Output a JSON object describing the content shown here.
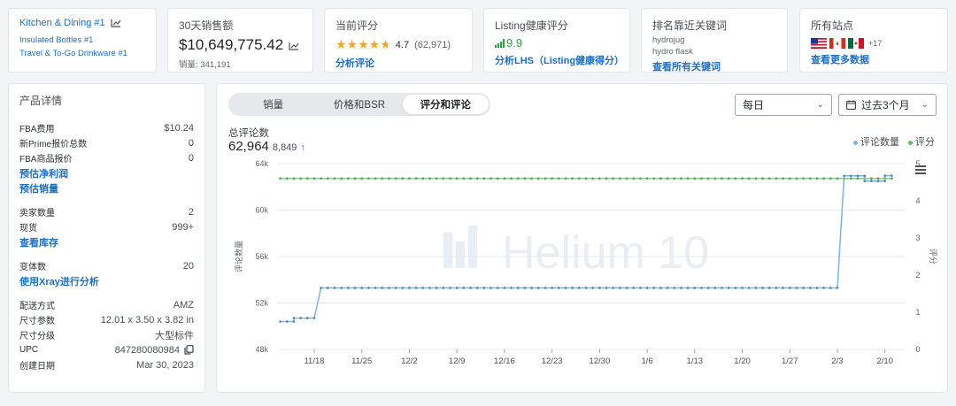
{
  "top": {
    "category": {
      "main_label": "Kitchen & Dining #1",
      "sub1": "Insulated Bottles #1",
      "sub2": "Travel & To-Go Drinkware #1"
    },
    "sales": {
      "title": "30天销售额",
      "value": "$10,649,775.42",
      "units_label": "销量:",
      "units": "341,191"
    },
    "rating": {
      "title": "当前评分",
      "stars": "★★★★",
      "half": "★",
      "score": "4.7",
      "count": "(62,971)",
      "link": "分析评论"
    },
    "listing": {
      "title": "Listing健康评分",
      "score": "9.9",
      "link": "分析LHS（Listing健康得分）"
    },
    "keywords": {
      "title": "排名靠近关键词",
      "kw1": "hydrojug",
      "kw2": "hydro flask",
      "link": "查看所有关键词"
    },
    "sites": {
      "title": "所有站点",
      "more": "+17",
      "link": "查看更多数据"
    }
  },
  "product": {
    "title": "产品详情",
    "rows": [
      {
        "label": "FBA费用",
        "value": "$10.24"
      },
      {
        "label": "新Prime报价总数",
        "value": "0"
      },
      {
        "label": "FBA商品报价",
        "value": "0"
      }
    ],
    "link_profit": "预估净利润",
    "link_sales": "预估销量",
    "rows2": [
      {
        "label": "卖家数量",
        "value": "2"
      },
      {
        "label": "现货",
        "value": "999+"
      }
    ],
    "link_inventory": "查看库存",
    "rows3": [
      {
        "label": "变体数",
        "value": "20"
      }
    ],
    "link_xray": "使用Xray进行分析",
    "rows4": [
      {
        "label": "配送方式",
        "value": "AMZ"
      },
      {
        "label": "尺寸参数",
        "value": "12.01 x 3.50 x 3.82 in"
      },
      {
        "label": "尺寸分级",
        "value": "大型标件"
      },
      {
        "label": "UPC",
        "value": "847280080984"
      },
      {
        "label": "创建日期",
        "value": "Mar 30, 2023"
      }
    ]
  },
  "chart_panel": {
    "tabs": [
      "销量",
      "价格和BSR",
      "评分和评论"
    ],
    "active_tab": 2,
    "interval": "每日",
    "range": "过去3个月",
    "title": "总评论数",
    "total": "62,964",
    "delta": "8,849"
  },
  "colors": {
    "reviews": "#7fb2e5",
    "rating": "#5fbf5f",
    "link": "#1b6fc9"
  },
  "chart_data": {
    "type": "line",
    "title": "",
    "x_ticks": [
      "11/18",
      "11/25",
      "12/2",
      "12/9",
      "12/16",
      "12/23",
      "12/30",
      "1/6",
      "1/13",
      "1/20",
      "1/27",
      "2/3",
      "2/10"
    ],
    "y_left": {
      "label": "评论数量",
      "ticks": [
        "48k",
        "52k",
        "56k",
        "60k",
        "64k"
      ],
      "ylim": [
        48000,
        64000
      ]
    },
    "y_right": {
      "label": "评分",
      "ticks": [
        "0",
        "1",
        "2",
        "3",
        "4",
        "5"
      ],
      "ylim": [
        0,
        5
      ]
    },
    "legend": [
      "评论数量",
      "评分"
    ],
    "watermark": "Helium 10",
    "series": [
      {
        "name": "评论数量",
        "segments": [
          {
            "from_day": -5,
            "to_day": -3,
            "value": 50400
          },
          {
            "from_day": -3,
            "to_day": 0,
            "value": 50700
          },
          {
            "from_day": 1,
            "to_day": 77,
            "value": 53300
          },
          {
            "from_day": 78,
            "to_day": 81,
            "value": 62950
          },
          {
            "from_day": 81,
            "to_day": 84,
            "value": 62500
          },
          {
            "from_day": 84,
            "to_day": 85,
            "value": 62964
          }
        ]
      },
      {
        "name": "评分",
        "value": 4.6
      }
    ]
  }
}
